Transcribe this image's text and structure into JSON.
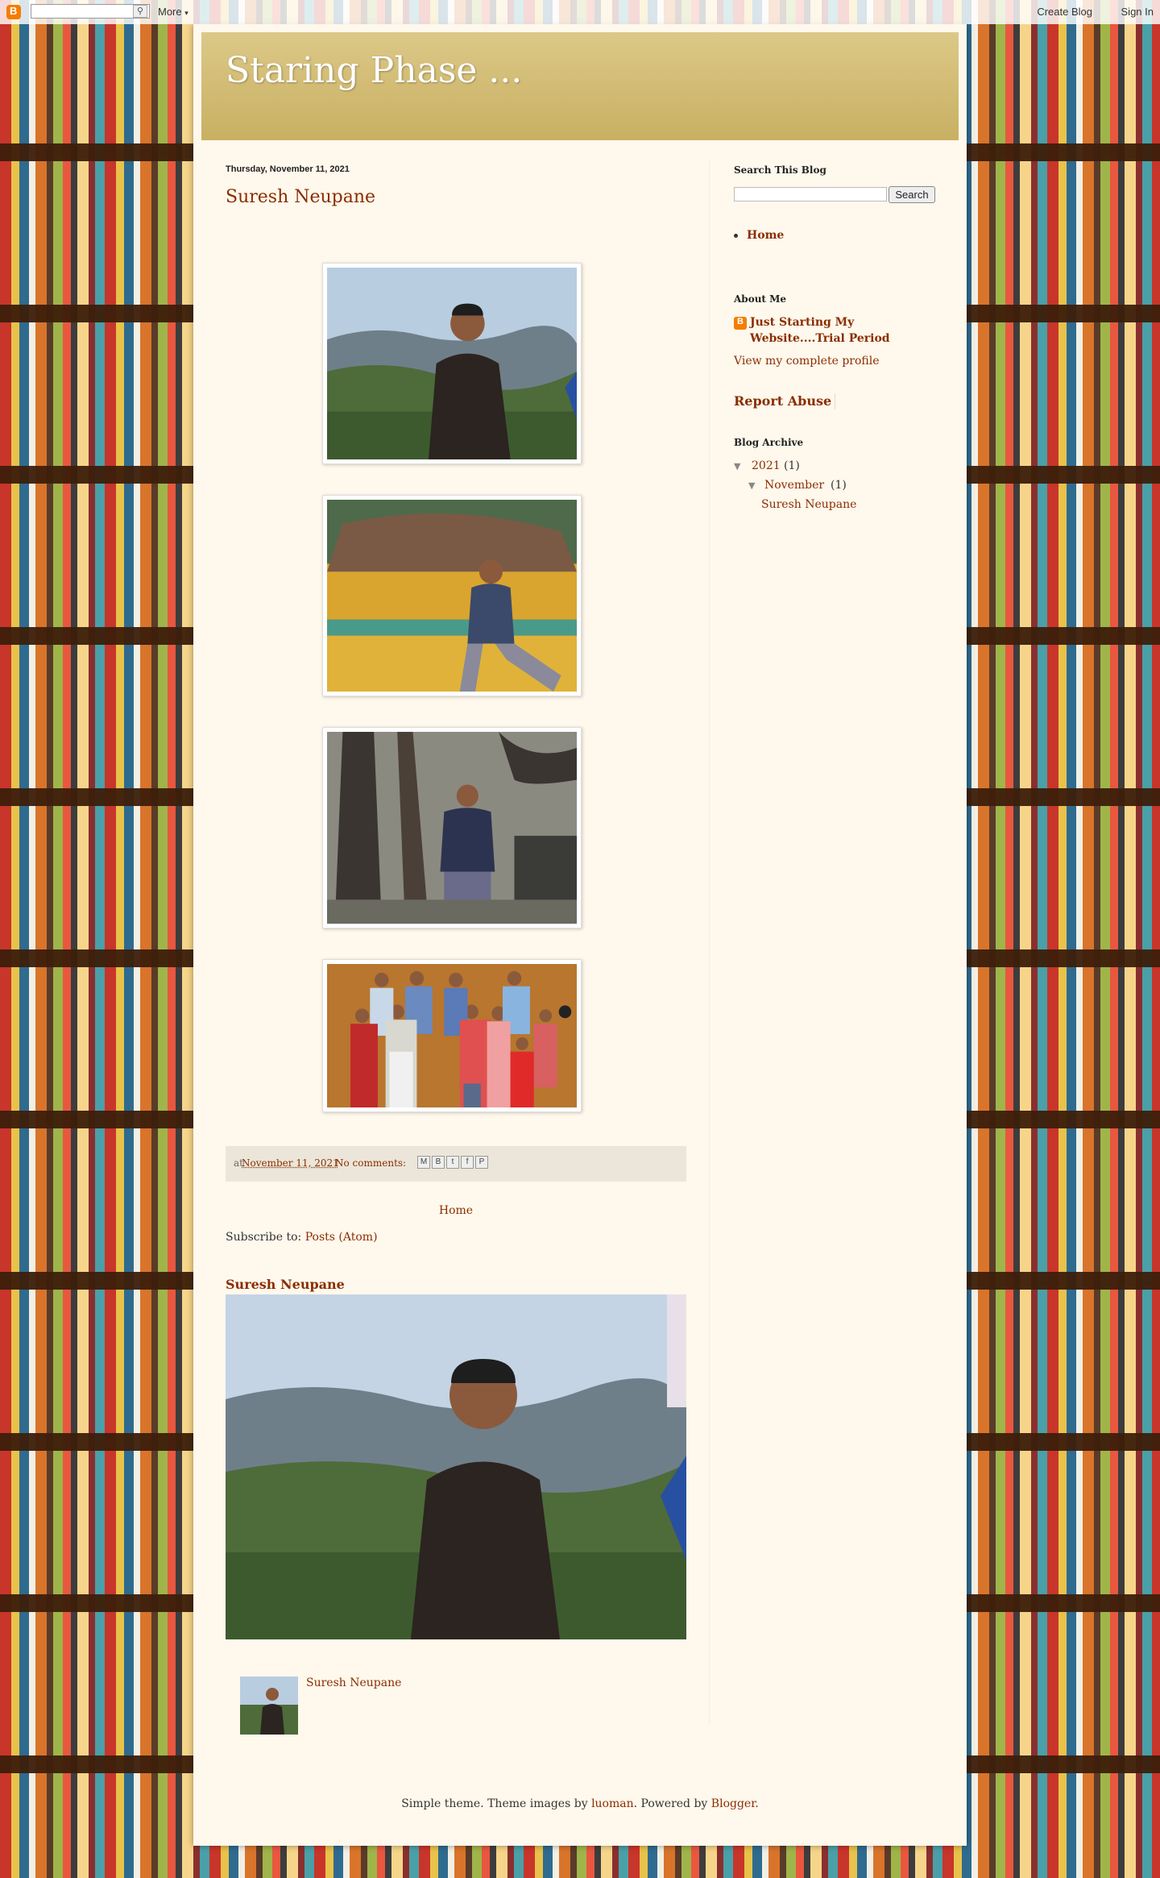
{
  "navbar": {
    "more_label": "More",
    "create_blog_label": "Create Blog",
    "sign_in_label": "Sign In"
  },
  "header": {
    "blog_title": "Staring Phase ..."
  },
  "post": {
    "date": "Thursday, November 11, 2021",
    "title": "Suresh Neupane",
    "footer": {
      "posted_at_prefix": "at",
      "timestamp": "November 11, 2021",
      "comments": "No comments:",
      "share_icons": [
        "email-icon",
        "blogthis-icon",
        "twitter-icon",
        "facebook-icon",
        "pinterest-icon"
      ]
    }
  },
  "nav": {
    "home_label": "Home",
    "subscribe_prefix": "Subscribe to:",
    "subscribe_link": "Posts (Atom)"
  },
  "popular": {
    "title": "Suresh Neupane",
    "item_label": "Suresh Neupane"
  },
  "sidebar": {
    "search": {
      "title": "Search This Blog",
      "button_label": "Search"
    },
    "pages": {
      "home_label": "Home"
    },
    "about": {
      "title": "About Me",
      "name": "Just Starting My Website....Trial Period",
      "profile_link": "View my complete profile"
    },
    "report_abuse": "Report Abuse",
    "archive": {
      "title": "Blog Archive",
      "year": "2021",
      "year_count": "(1)",
      "month": "November",
      "month_count": "(1)",
      "post": "Suresh Neupane"
    }
  },
  "footer": {
    "text_prefix": "Simple theme. Theme images by",
    "author_link": "luoman",
    "powered_prefix": ". Powered by",
    "blogger_link": "Blogger",
    "suffix": "."
  }
}
